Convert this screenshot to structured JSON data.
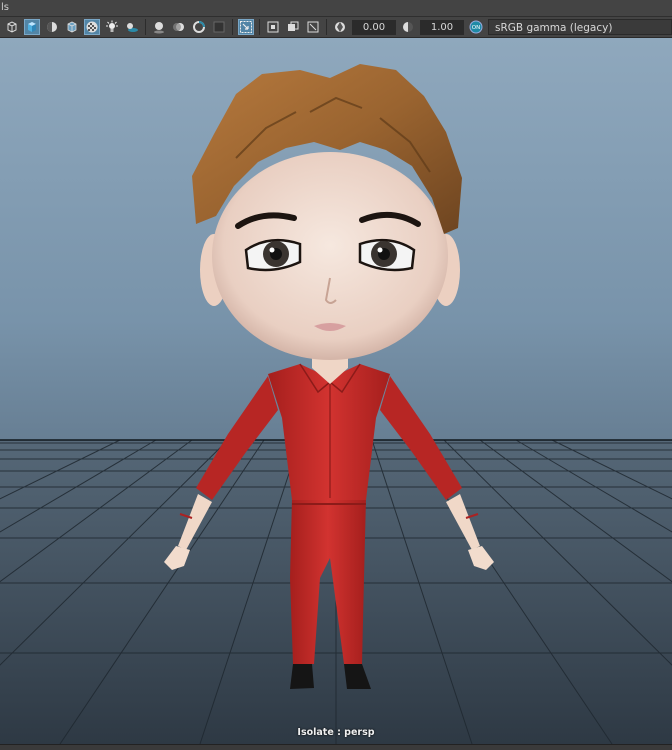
{
  "menu": {
    "partial_label": "ls"
  },
  "toolbar": {
    "icons": [
      "wireframe-cube-icon",
      "shaded-cube-icon",
      "wireframe-on-shaded-icon",
      "textured-cube-icon",
      "checker-texture-icon",
      "use-all-lights-icon",
      "shadows-icon",
      "ambient-occlusion-icon",
      "motion-blur-icon",
      "anti-aliasing-icon",
      "depth-of-field-icon",
      "isolate-select-icon",
      "xray-icon",
      "xray-active-icon",
      "xray-joints-icon",
      "backface-culling-icon",
      "exposure-icon",
      "gamma-icon",
      "color-management-icon"
    ],
    "exposure_value": "0.00",
    "gamma_value": "1.00",
    "colorspace": "sRGB gamma (legacy)"
  },
  "viewport": {
    "hud_label": "Isolate : persp",
    "colors": {
      "sky_top": "#8fa8bd",
      "floor": "#3a4652",
      "shirt": "#c42a27",
      "hair": "#a26a34",
      "skin": "#efd9cc"
    }
  }
}
